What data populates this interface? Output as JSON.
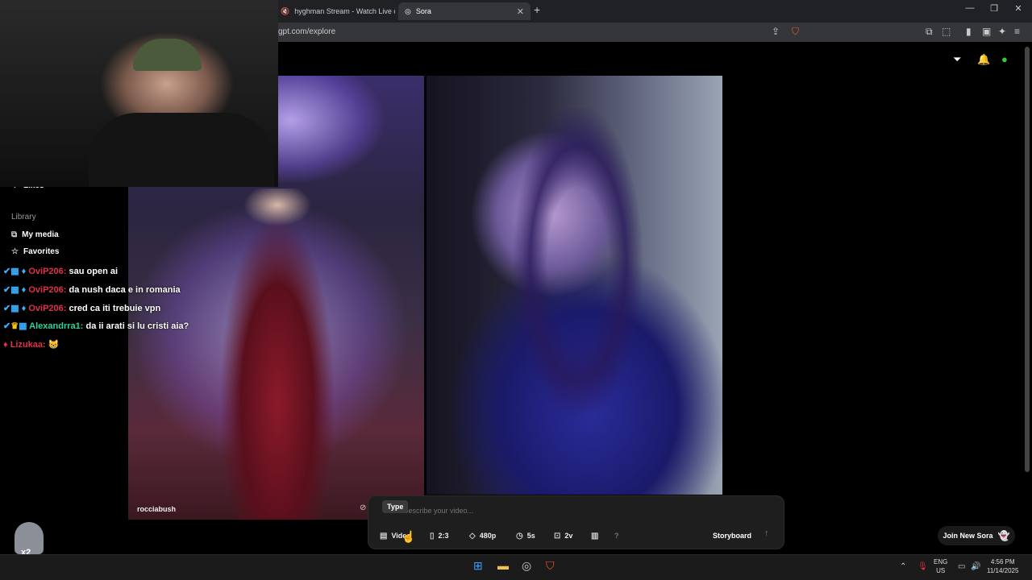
{
  "browser": {
    "tabs": [
      {
        "label": "hyghman Stream - Watch Live on",
        "active": false
      },
      {
        "label": "Sora",
        "active": true
      }
    ],
    "url": "gpt.com/explore"
  },
  "sidebar": {
    "items_top": [
      {
        "label": "Likes",
        "icon": "heart-icon"
      }
    ],
    "library_heading": "Library",
    "library_items": [
      {
        "label": "My media",
        "icon": "media-icon"
      },
      {
        "label": "Favorites",
        "icon": "star-icon"
      }
    ]
  },
  "feed": {
    "author": "rocciabush"
  },
  "chat": [
    {
      "user": "OviP206",
      "message": "sau open ai"
    },
    {
      "user": "OviP206",
      "message": "da nush daca e in romania"
    },
    {
      "user": "OviP206",
      "message": "cred ca iti trebuie vpn"
    },
    {
      "user": "Alexandrra1",
      "message": "da ii arati si lu cristi aia?"
    },
    {
      "user": "Lizukaa",
      "message": "😸"
    }
  ],
  "prompt": {
    "placeholder": "Describe your video...",
    "tooltip": "Type",
    "buttons": {
      "type": "Video",
      "aspect": "2:3",
      "resolution": "480p",
      "duration": "5s",
      "variations": "2v",
      "help": "?",
      "storyboard": "Storyboard"
    }
  },
  "join_button": "Join New Sora",
  "mascot_label": "x2",
  "taskbar": {
    "lang": "ENG",
    "region": "US",
    "time": "4:56 PM",
    "date": "11/14/2025"
  },
  "colors": {
    "accent_red": "#e0304a",
    "accent_teal": "#2fd0a0"
  }
}
